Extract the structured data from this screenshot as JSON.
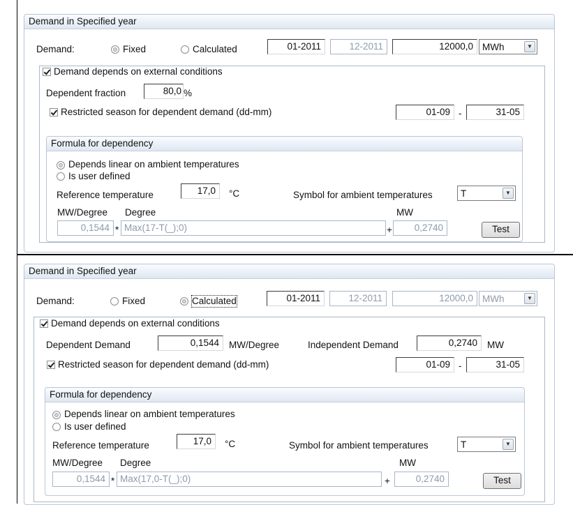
{
  "panel1": {
    "group_title": "Demand in Specified year",
    "demand_label": "Demand:",
    "fixed_label": "Fixed",
    "calculated_label": "Calculated",
    "selected": "Fixed",
    "from_period": "01-2011",
    "to_period": "12-2011",
    "amount": "12000,0",
    "unit": "MWh",
    "external_label": "Demand depends on external conditions",
    "dependent_fraction_label": "Dependent fraction",
    "dependent_fraction_value": "80,0",
    "percent_sign": "%",
    "restricted_label": "Restricted season for dependent demand (dd-mm)",
    "season_from": "01-09",
    "season_dash": "-",
    "season_to": "31-05",
    "formula": {
      "title": "Formula for dependency",
      "linear_label": "Depends linear on ambient temperatures",
      "user_label": "Is user defined",
      "ref_label": "Reference temperature",
      "ref_value": "17,0",
      "ref_unit": "°C",
      "symbol_label": "Symbol for ambient temperatures",
      "symbol_value": "T",
      "mw_degree_label": "MW/Degree",
      "degree_label": "Degree",
      "mw_label": "MW",
      "mw_degree_value": "0,1544",
      "times": "*",
      "degree_value": "Max(17-T(_);0)",
      "plus": "+",
      "mw_value": "0,2740",
      "test_label": "Test"
    }
  },
  "panel2": {
    "group_title": "Demand in Specified year",
    "demand_label": "Demand:",
    "fixed_label": "Fixed",
    "calculated_label": "Calculated",
    "selected": "Calculated",
    "from_period": "01-2011",
    "to_period": "12-2011",
    "amount": "12000,0",
    "unit": "MWh",
    "external_label": "Demand depends on external conditions",
    "dependent_demand_label": "Dependent Demand",
    "dependent_demand_value": "0,1544",
    "dependent_unit": "MW/Degree",
    "independent_label": "Independent Demand",
    "independent_value": "0,2740",
    "independent_unit": "MW",
    "restricted_label": "Restricted season for dependent demand (dd-mm)",
    "season_from": "01-09",
    "season_dash": "-",
    "season_to": "31-05",
    "formula": {
      "title": "Formula for dependency",
      "linear_label": "Depends linear on ambient temperatures",
      "user_label": "Is user defined",
      "ref_label": "Reference temperature",
      "ref_value": "17,0",
      "ref_unit": "°C",
      "symbol_label": "Symbol for ambient temperatures",
      "symbol_value": "T",
      "mw_degree_label": "MW/Degree",
      "degree_label": "Degree",
      "mw_label": "MW",
      "mw_degree_value": "0,1544",
      "times": "*",
      "degree_value": "Max(17,0-T(_);0)",
      "plus": "+",
      "mw_value": "0,2740",
      "test_label": "Test"
    }
  }
}
